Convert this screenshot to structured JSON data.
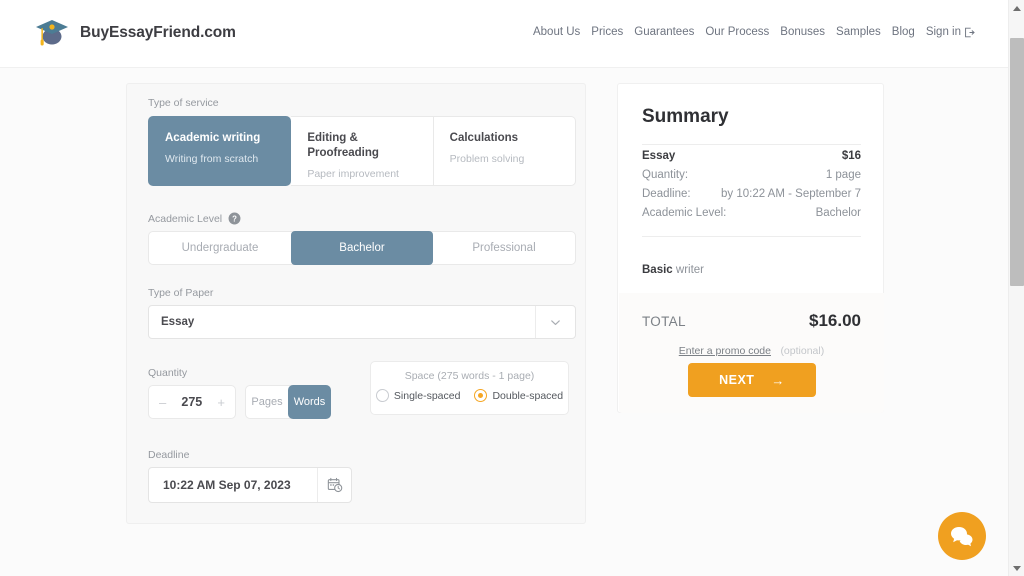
{
  "header": {
    "logo_icon": "graduation-cap-icon",
    "logo_text": "BuyEssayFriend.com",
    "nav": [
      {
        "label": "About Us"
      },
      {
        "label": "Prices"
      },
      {
        "label": "Guarantees"
      },
      {
        "label": "Our Process"
      },
      {
        "label": "Bonuses"
      },
      {
        "label": "Samples"
      },
      {
        "label": "Blog"
      }
    ],
    "signin_label": "Sign in",
    "signin_icon": "sign-in-icon"
  },
  "form": {
    "service": {
      "label": "Type of service",
      "options": [
        {
          "title": "Academic writing",
          "subtitle": "Writing from scratch",
          "selected": true
        },
        {
          "title": "Editing & Proofreading",
          "subtitle": "Paper improvement",
          "selected": false
        },
        {
          "title": "Calculations",
          "subtitle": "Problem solving",
          "selected": false
        }
      ]
    },
    "academic_level": {
      "label": "Academic Level",
      "help_icon": "question-mark-icon",
      "options": [
        {
          "label": "Undergraduate",
          "selected": false
        },
        {
          "label": "Bachelor",
          "selected": true
        },
        {
          "label": "Professional",
          "selected": false
        }
      ]
    },
    "paper_type": {
      "label": "Type of Paper",
      "value": "Essay",
      "caret_icon": "chevron-down-icon"
    },
    "quantity": {
      "label": "Quantity",
      "value": "275",
      "decrement": "–",
      "increment": "+",
      "units": [
        {
          "label": "Pages",
          "selected": false
        },
        {
          "label": "Words",
          "selected": true
        }
      ]
    },
    "spacing": {
      "title": "Space (275 words - 1 page)",
      "options": [
        {
          "label": "Single-spaced",
          "selected": false
        },
        {
          "label": "Double-spaced",
          "selected": true
        }
      ]
    },
    "deadline": {
      "label": "Deadline",
      "value": "10:22 AM Sep 07, 2023",
      "calendar_icon": "calendar-clock-icon"
    }
  },
  "summary": {
    "title": "Summary",
    "rows": [
      {
        "key": "Essay",
        "value": "$16",
        "key_bold": true,
        "value_bold": true
      },
      {
        "key": "Quantity:",
        "value": "1 page",
        "key_bold": false,
        "value_bold": false
      },
      {
        "key": "Deadline:",
        "value": "by 10:22 AM - September 7",
        "key_bold": false,
        "value_bold": false
      },
      {
        "key": "Academic Level:",
        "value": "Bachelor",
        "key_bold": false,
        "value_bold": false
      }
    ],
    "writer_tier": "Basic",
    "writer_suffix": " writer",
    "total_label": "TOTAL",
    "total_amount": "$16.00",
    "promo_link": "Enter a promo code",
    "promo_optional": "(optional)",
    "next_label": "NEXT",
    "next_arrow": "→"
  },
  "chat": {
    "icon": "chat-bubbles-icon"
  },
  "colors": {
    "accent_orange": "#f0a020",
    "selected_slate": "#6b8ca3",
    "page_bg": "#fbfbfb"
  }
}
